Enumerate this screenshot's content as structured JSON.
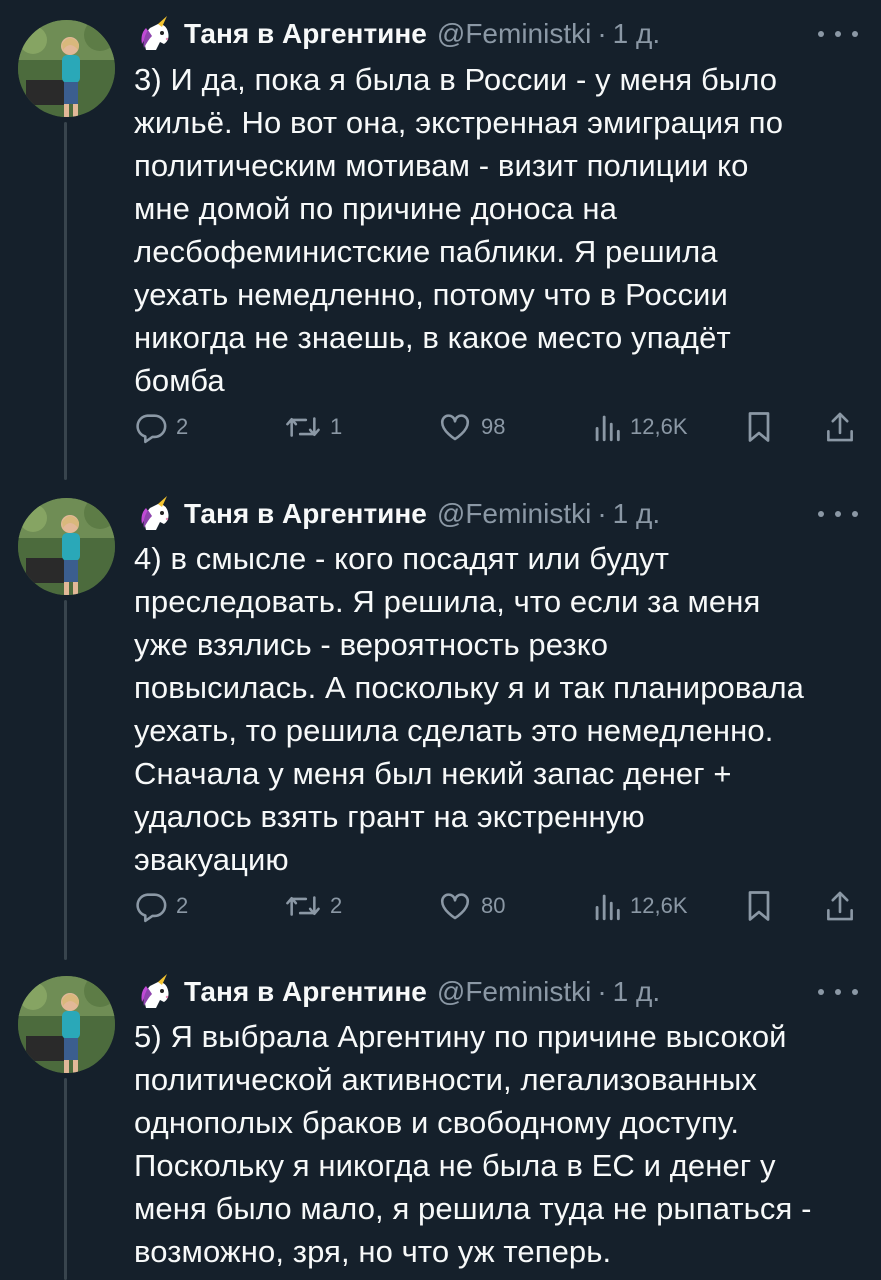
{
  "tweets": [
    {
      "author": {
        "name": "Таня в Аргентине",
        "handle": "@Feministki",
        "separator": "·",
        "time": "1 д.",
        "emoji": "unicorn-emoji"
      },
      "text": "3) И да, пока я была в России - у меня было\nжильё. Но вот она, экстренная эмиграция по\nполитическим мотивам - визит полиции ко\nмне домой по причине доноса на\nлесбофеминистские паблики. Я решила\nуехать немедленно, потому что в России\nникогда не знаешь, в какое место упадёт\nбомба",
      "stats": {
        "replies": "2",
        "retweets": "1",
        "likes": "98",
        "views": "12,6K"
      }
    },
    {
      "author": {
        "name": "Таня в Аргентине",
        "handle": "@Feministki",
        "separator": "·",
        "time": "1 д.",
        "emoji": "unicorn-emoji"
      },
      "text": "4) в смысле - кого посадят или будут\nпреследовать. Я решила, что если за меня\nуже взялись - вероятность резко\nповысилась. А поскольку я и так планировала\nуехать, то решила сделать это немедленно.\nСначала у меня был некий запас денег +\nудалось взять грант на экстренную\nэвакуацию",
      "stats": {
        "replies": "2",
        "retweets": "2",
        "likes": "80",
        "views": "12,6K"
      }
    },
    {
      "author": {
        "name": "Таня в Аргентине",
        "handle": "@Feministki",
        "separator": "·",
        "time": "1 д.",
        "emoji": "unicorn-emoji"
      },
      "text": "5) Я выбрала Аргентину по причине высокой\nполитической активности, легализованных\nоднополых браков и свободному доступу.\nПоскольку я никогда не была в ЕС и денег у\nменя было мало, я решила туда не рыпаться -\nвозможно, зря, но что уж теперь."
    }
  ],
  "colors": {
    "background": "#15202b",
    "text_primary": "#f7f9f9",
    "text_secondary": "#8b98a5",
    "thread_line": "#38444d"
  },
  "icons": [
    "reply-icon",
    "retweet-icon",
    "like-icon",
    "views-icon",
    "bookmark-icon",
    "share-icon",
    "more-icon",
    "unicorn-emoji"
  ]
}
